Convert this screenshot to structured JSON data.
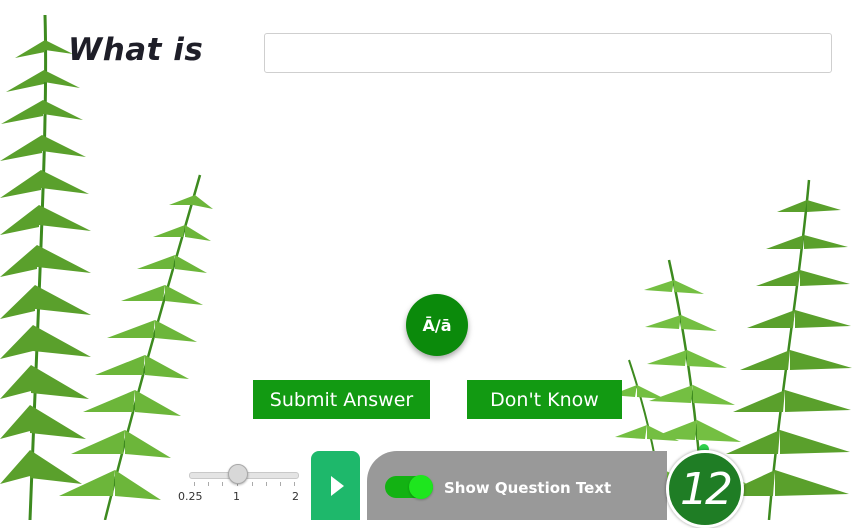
{
  "question": {
    "prompt": "What is",
    "answer_value": "",
    "answer_placeholder": ""
  },
  "buttons": {
    "macron": "Ā/ā",
    "submit": "Submit Answer",
    "dont_know": "Don't Know"
  },
  "speed_slider": {
    "labels": [
      "0.25",
      "1",
      "2"
    ],
    "value": 1
  },
  "audio": {
    "play_icon": "play-icon"
  },
  "show_question_toggle": {
    "label": "Show Question Text",
    "enabled": true
  },
  "level_badge": {
    "value": "12"
  },
  "colors": {
    "primary_green": "#129a12",
    "macron_green": "#0b8a0b",
    "play_green": "#1eb86b",
    "panel_gray": "#999999",
    "badge_green": "#1f7d25"
  }
}
